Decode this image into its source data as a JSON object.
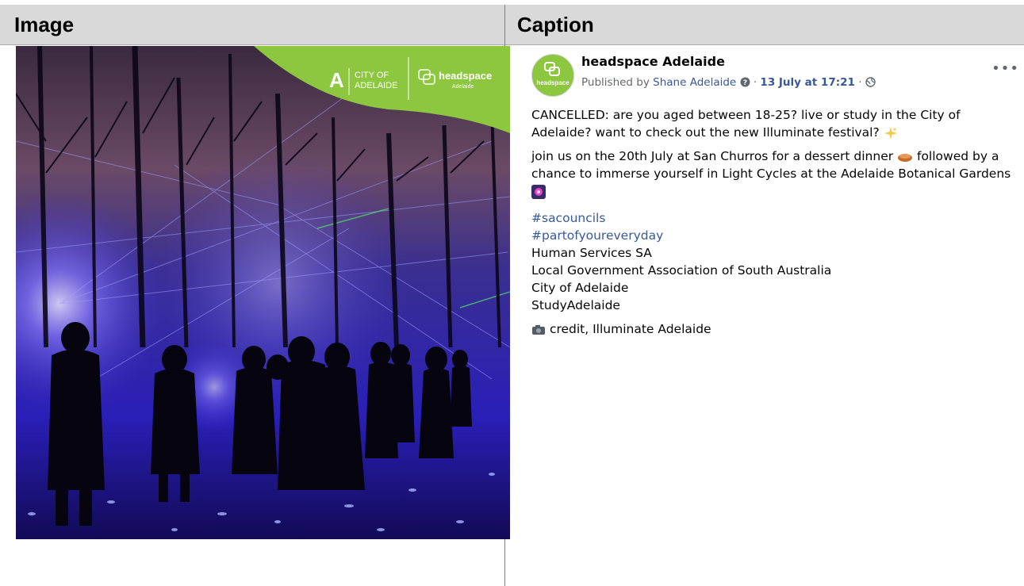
{
  "table": {
    "col_image_header": "Image",
    "col_caption_header": "Caption"
  },
  "image": {
    "banner": {
      "brand1_line1": "CITY OF",
      "brand1_line2": "ADELAIDE",
      "brand2_name": "headspace",
      "brand2_sub": "Adelaide",
      "banner_color": "#8dc63f"
    }
  },
  "post": {
    "avatar_text": "headspace",
    "page_name": "headspace Adelaide",
    "published_prefix": "Published by",
    "publisher": "Shane Adelaide",
    "separator": "·",
    "date": "13 July at 17:21",
    "more_icon": "ellipsis-icon",
    "paragraph1": "CANCELLED: are you aged between 18-25? live or study in the City of Adelaide? want to check out the new Illuminate festival?",
    "paragraph2_a": "join us on the 20th July at San Churros for a dessert dinner",
    "paragraph2_b": "followed by a chance to immerse yourself in Light Cycles at the Adelaide Botanical Gardens",
    "hashtags": [
      "#sacouncils",
      "#partofyoureveryday"
    ],
    "tagged": [
      "Human Services SA",
      "Local Government Association of South Australia",
      "City of Adelaide",
      "StudyAdelaide"
    ],
    "credit": "credit, Illuminate Adelaide",
    "link_color": "#385898"
  }
}
